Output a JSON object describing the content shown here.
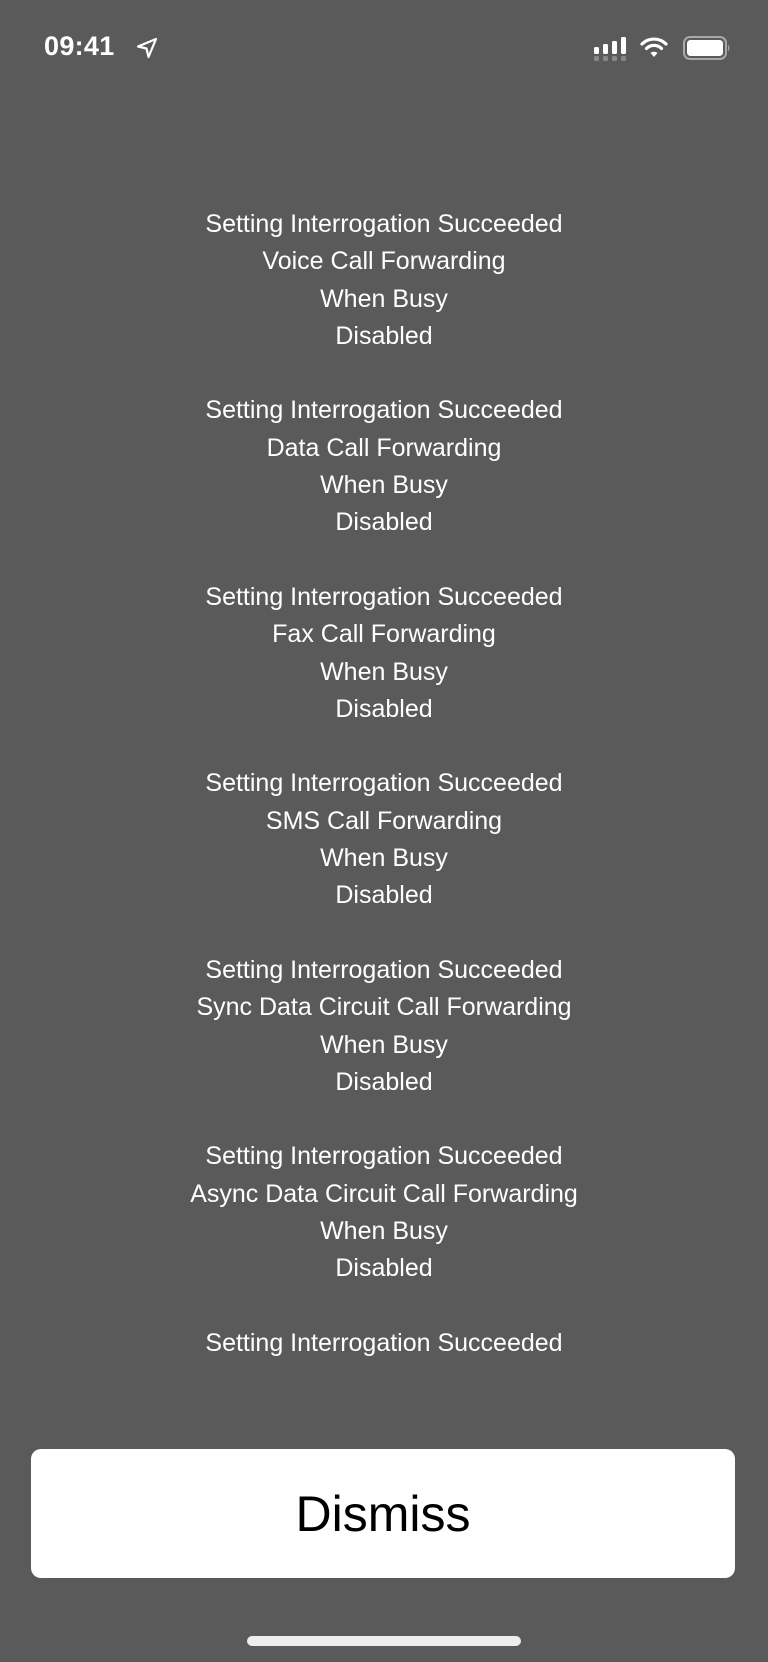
{
  "status_bar": {
    "time": "09:41",
    "location_icon": "location-arrow-icon",
    "signal_icon": "cellular-signal-icon",
    "wifi_icon": "wifi-icon",
    "battery_icon": "battery-icon"
  },
  "message": {
    "blocks": [
      {
        "status": "Setting Interrogation Succeeded",
        "service": "Voice Call Forwarding",
        "condition": "When Busy",
        "state": "Disabled"
      },
      {
        "status": "Setting Interrogation Succeeded",
        "service": "Data Call Forwarding",
        "condition": "When Busy",
        "state": "Disabled"
      },
      {
        "status": "Setting Interrogation Succeeded",
        "service": "Fax Call Forwarding",
        "condition": "When Busy",
        "state": "Disabled"
      },
      {
        "status": "Setting Interrogation Succeeded",
        "service": "SMS Call Forwarding",
        "condition": "When Busy",
        "state": "Disabled"
      },
      {
        "status": "Setting Interrogation Succeeded",
        "service": "Sync Data Circuit Call Forwarding",
        "condition": "When Busy",
        "state": "Disabled"
      },
      {
        "status": "Setting Interrogation Succeeded",
        "service": "Async Data Circuit Call Forwarding",
        "condition": "When Busy",
        "state": "Disabled"
      },
      {
        "status": "Setting Interrogation Succeeded"
      }
    ]
  },
  "dismiss_button": {
    "label": "Dismiss"
  },
  "colors": {
    "background": "#5a5a5a",
    "text": "#ffffff",
    "button_background": "#ffffff",
    "button_text": "#000000"
  }
}
